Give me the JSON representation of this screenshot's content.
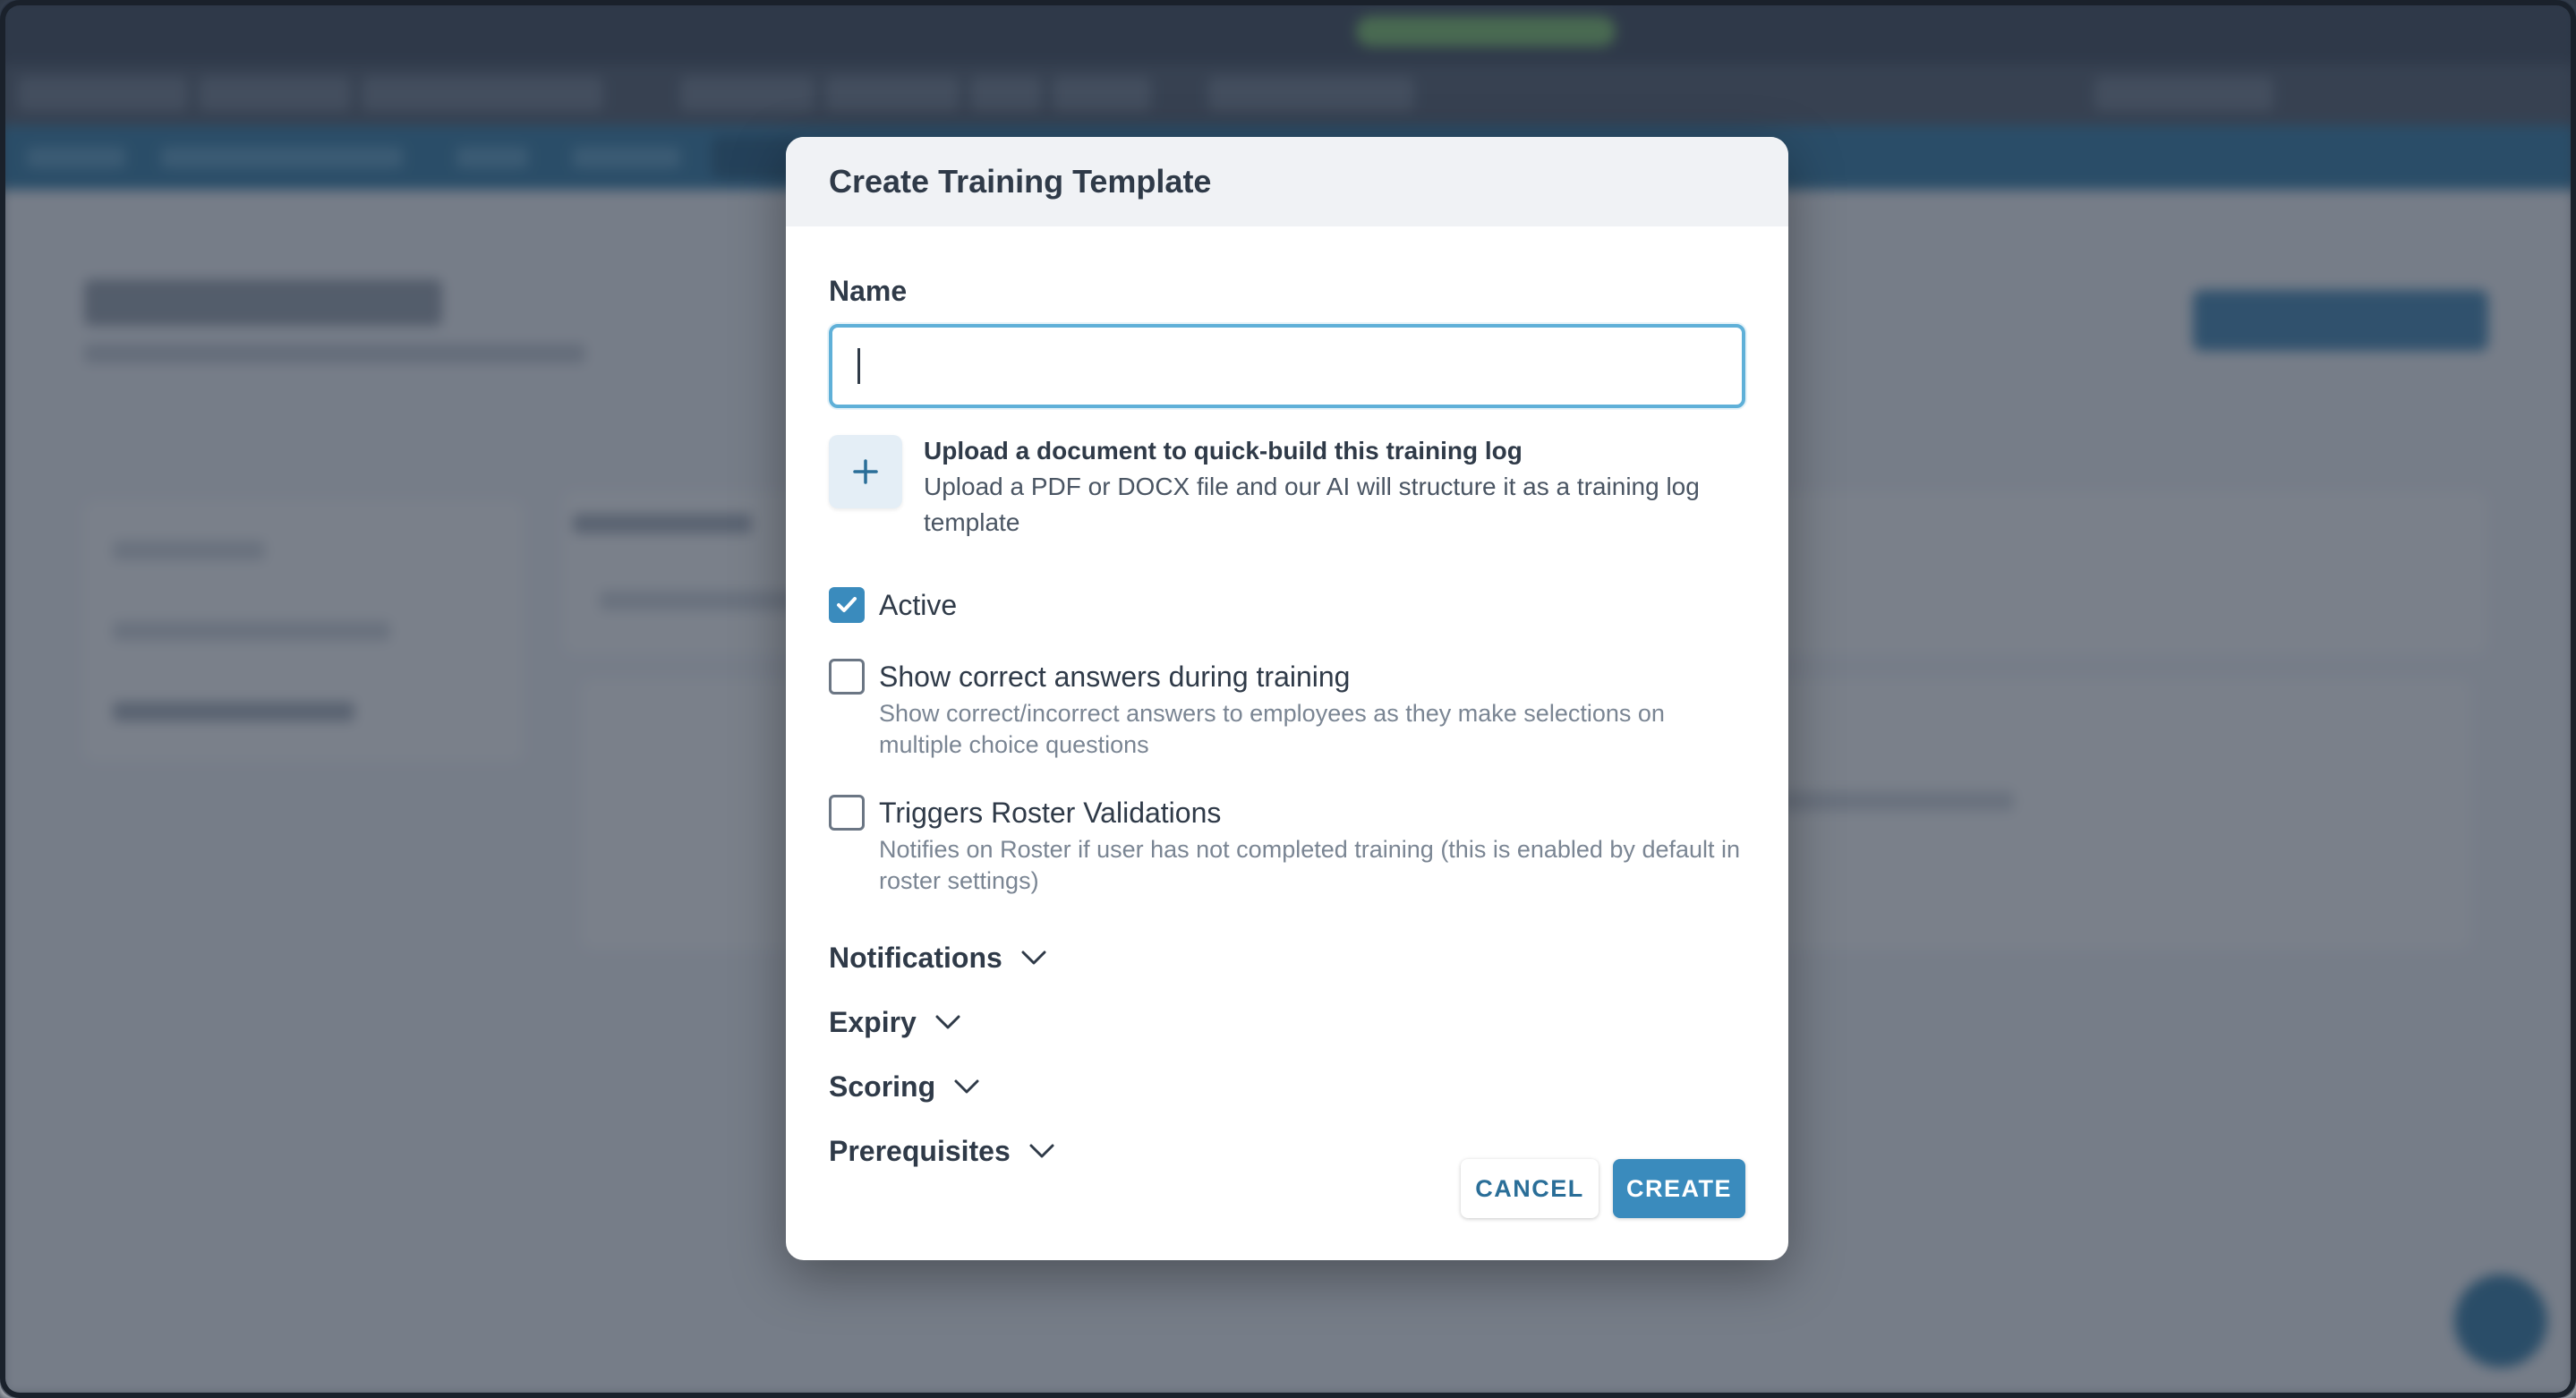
{
  "modal": {
    "title": "Create Training Template",
    "name_label": "Name",
    "name_value": "",
    "upload": {
      "title": "Upload a document to quick-build this training log",
      "description": "Upload a PDF or DOCX file and our AI will structure it as a training log template"
    },
    "options": [
      {
        "label": "Active",
        "checked": true,
        "description": ""
      },
      {
        "label": "Show correct answers during training",
        "checked": false,
        "description": "Show correct/incorrect answers to employees as they make selections on multiple choice questions"
      },
      {
        "label": "Triggers Roster Validations",
        "checked": false,
        "description": "Notifies on Roster if user has not completed training (this is enabled by default in roster settings)"
      }
    ],
    "sections": [
      {
        "label": "Notifications",
        "icon": "chevron-down-icon"
      },
      {
        "label": "Expiry",
        "icon": "chevron-down-icon"
      },
      {
        "label": "Scoring",
        "icon": "chevron-down-icon"
      },
      {
        "label": "Prerequisites",
        "icon": "chevron-down-icon"
      }
    ],
    "cancel_label": "CANCEL",
    "create_label": "CREATE"
  },
  "colors": {
    "accent": "#3a8bbd",
    "input_focus": "#5fb0d8",
    "overlay": "#283242"
  }
}
